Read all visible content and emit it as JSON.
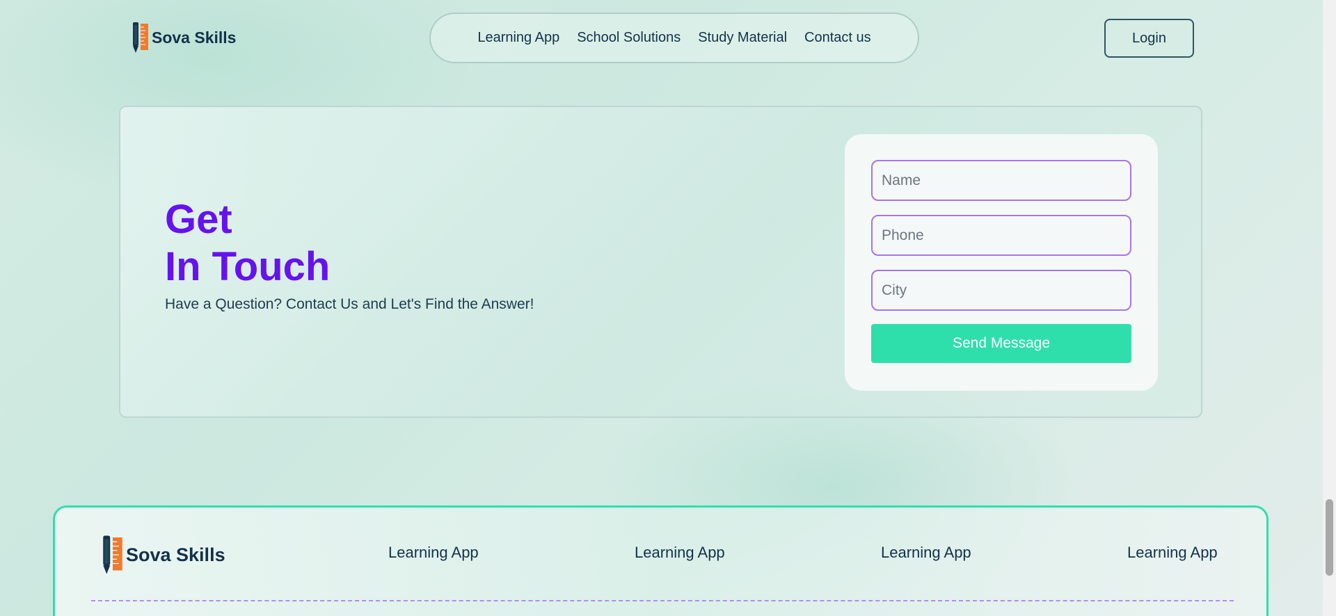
{
  "brand": {
    "name": "Sova Skills",
    "accent": "#6612f0",
    "button_color": "#2fdfab",
    "field_border": "#a873ea"
  },
  "header": {
    "nav": [
      "Learning App",
      "School Solutions",
      "Study Material",
      "Contact us"
    ],
    "login_label": "Login"
  },
  "contact": {
    "title_line1": "Get",
    "title_line2": "In Touch",
    "subtitle": "Have a Question? Contact Us and Let's Find the Answer!",
    "form": {
      "name_placeholder": "Name",
      "phone_placeholder": "Phone",
      "city_placeholder": "City",
      "submit_label": "Send Message"
    }
  },
  "footer": {
    "links": [
      "Learning App",
      "Learning App",
      "Learning App",
      "Learning App"
    ]
  },
  "icons": {
    "logo": "pencil-ruler-icon"
  }
}
